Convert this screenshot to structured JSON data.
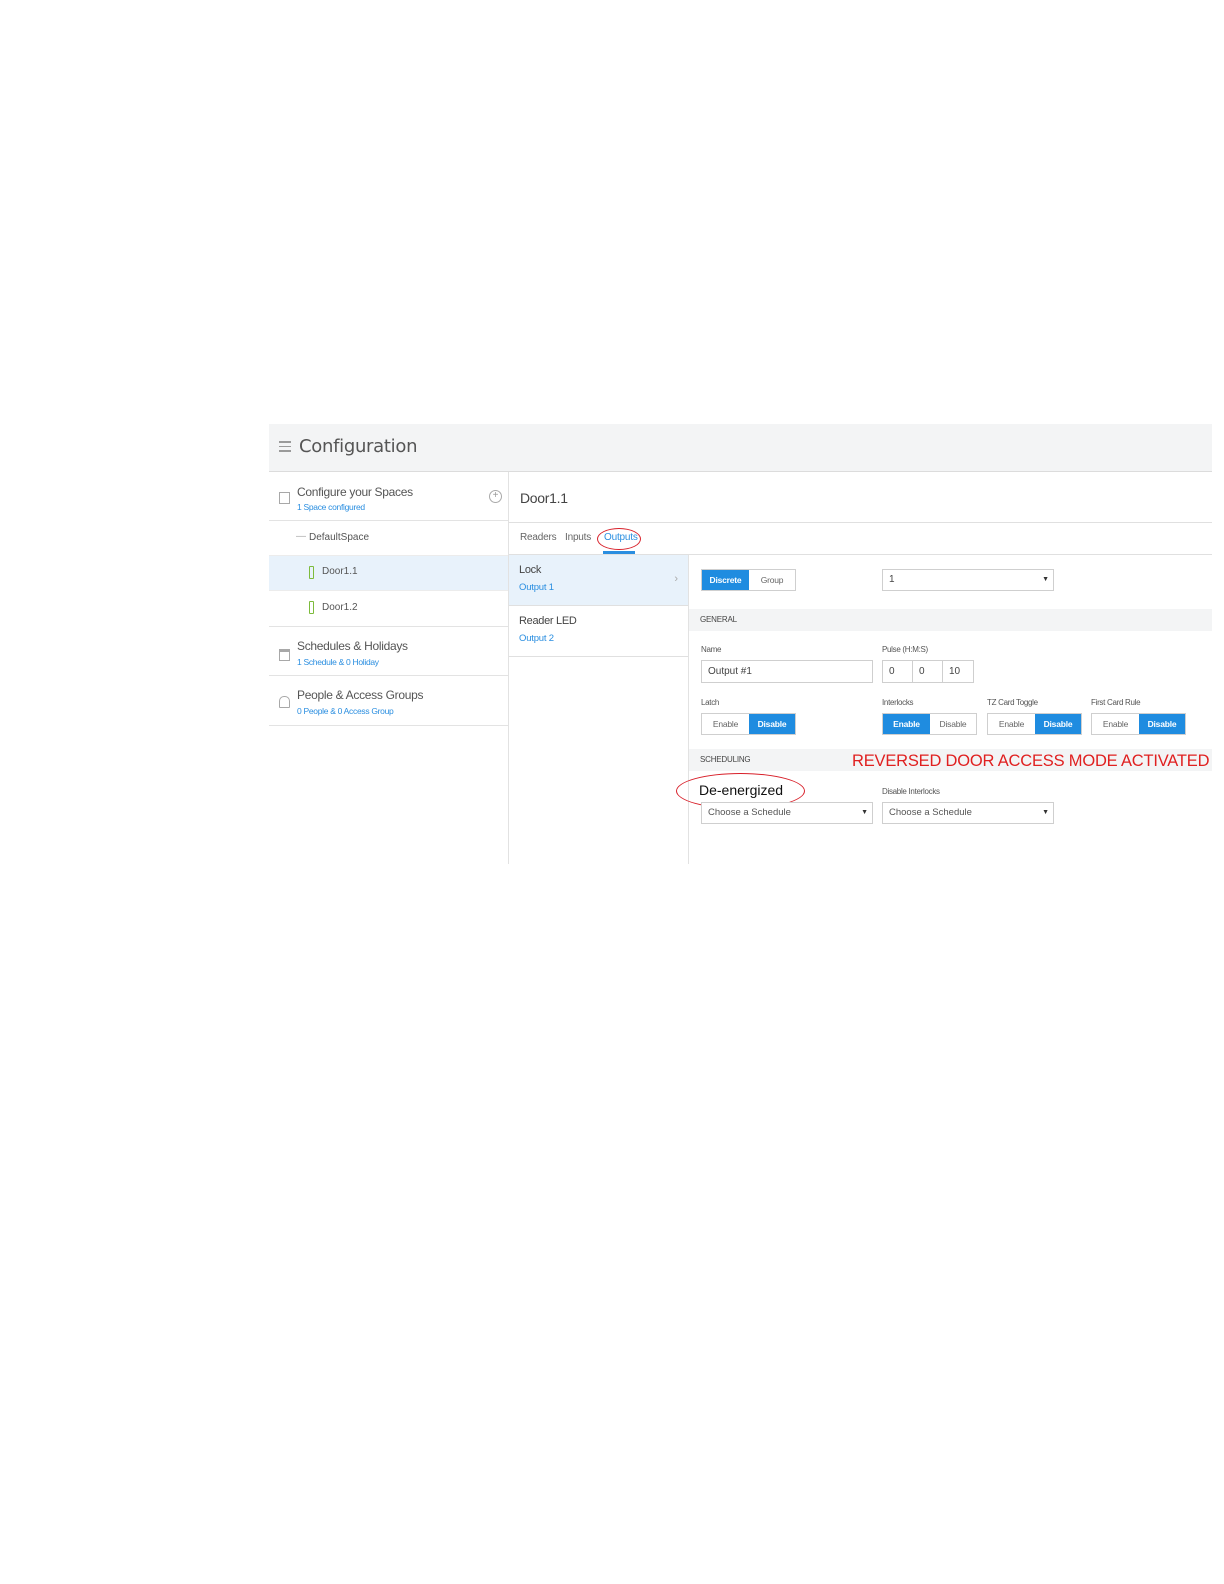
{
  "app": {
    "title": "Configuration"
  },
  "sidebar": {
    "spaces": {
      "title": "Configure your Spaces",
      "subtitle": "1 Space configured"
    },
    "default_space": "DefaultSpace",
    "doors": [
      {
        "label": "Door1.1",
        "selected": true
      },
      {
        "label": "Door1.2",
        "selected": false
      }
    ],
    "schedules": {
      "title": "Schedules & Holidays",
      "subtitle": "1 Schedule & 0 Holiday"
    },
    "people": {
      "title": "People & Access Groups",
      "subtitle": "0 People & 0 Access Group"
    }
  },
  "main": {
    "door_title": "Door1.1",
    "tabs": [
      {
        "label": "Readers"
      },
      {
        "label": "Inputs"
      },
      {
        "label": "Outputs",
        "active": true
      }
    ],
    "outputs": [
      {
        "name": "Lock",
        "sub": "Output 1",
        "selected": true
      },
      {
        "name": "Reader LED",
        "sub": "Output 2",
        "selected": false
      }
    ]
  },
  "detail": {
    "mode": {
      "discrete": "Discrete",
      "group": "Group"
    },
    "output_select_value": "1",
    "general_label": "GENERAL",
    "name_label": "Name",
    "name_value": "Output #1",
    "pulse_label": "Pulse (H:M:S)",
    "pulse": [
      "0",
      "0",
      "10"
    ],
    "latch_label": "Latch",
    "interlocks_label": "Interlocks",
    "tz_label": "TZ Card Toggle",
    "first_card_label": "First Card Rule",
    "enable": "Enable",
    "disable": "Disable",
    "scheduling_label": "SCHEDULING",
    "disable_interlocks_label": "Disable Interlocks",
    "schedule_placeholder": "Choose a Schedule"
  },
  "annotations": {
    "warning": "REVERSED DOOR ACCESS MODE ACTIVATED",
    "de_energized": "De-energized",
    "highlight_color": "#d8202a"
  },
  "colors": {
    "accent": "#1f8ce0",
    "link": "#2a8ee0"
  }
}
